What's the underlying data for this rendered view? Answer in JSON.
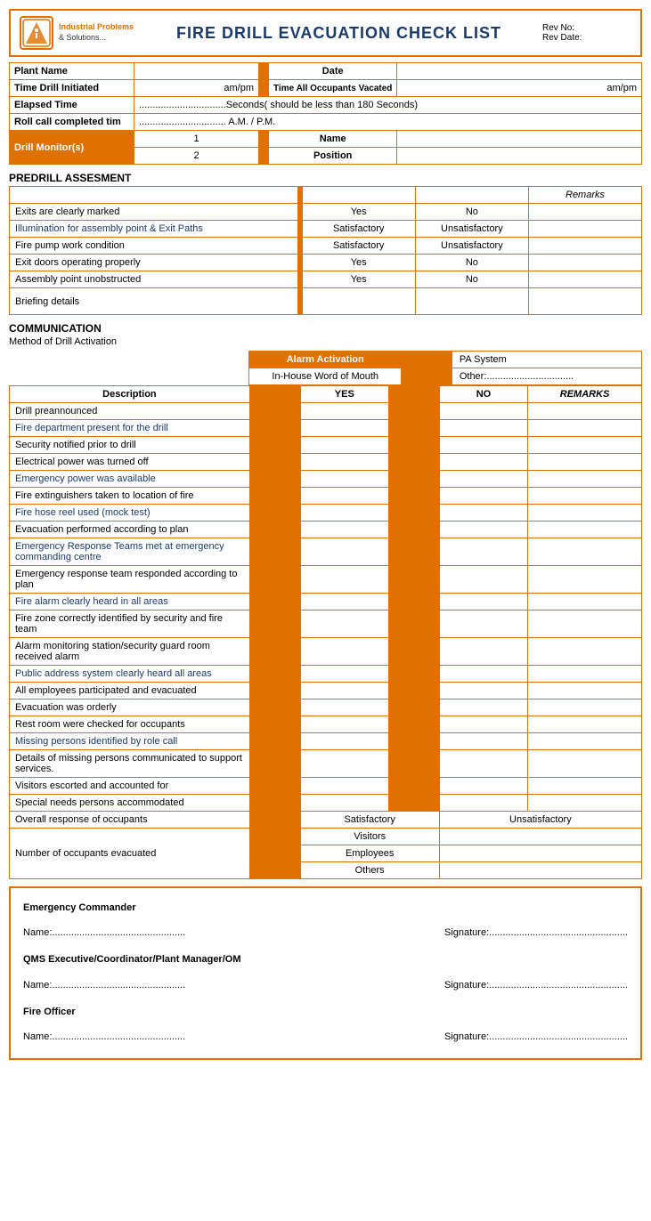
{
  "header": {
    "title": "FIRE DRILL EVACUATION CHECK LIST",
    "rev_no_label": "Rev No:",
    "rev_date_label": "Rev Date:",
    "logo_line1": "Industrial Problems",
    "logo_line2": "& Solutions..."
  },
  "form": {
    "plant_name_label": "Plant Name",
    "date_label": "Date",
    "time_drill_label": "Time Drill Initiated",
    "ampm1": "am/pm",
    "time_vacated_label": "Time All Occupants Vacated",
    "ampm2": "am/pm",
    "elapsed_label": "Elapsed Time",
    "elapsed_value": "................................Seconds( should be less than 180 Seconds)",
    "rollcall_label": "Roll call completed tim",
    "rollcall_value": "................................ A.M. / P.M.",
    "monitor_label": "Drill Monitor(s)",
    "monitor1_num": "1",
    "monitor1_field": "Name",
    "monitor2_num": "2",
    "monitor2_field": "Position"
  },
  "predrill": {
    "title": "PREDRILL ASSESMENT",
    "remarks_label": "Remarks",
    "rows": [
      {
        "label": "Exits are clearly marked",
        "col1": "Yes",
        "col2": "No",
        "blue": false
      },
      {
        "label": "Illumination for assembly point & Exit Paths",
        "col1": "Satisfactory",
        "col2": "Unsatisfactory",
        "blue": true
      },
      {
        "label": "Fire pump work condition",
        "col1": "Satisfactory",
        "col2": "Unsatisfactory",
        "blue": false
      },
      {
        "label": "Exit doors operating properly",
        "col1": "Yes",
        "col2": "No",
        "blue": false
      },
      {
        "label": "Assembly point unobstructed",
        "col1": "Yes",
        "col2": "No",
        "blue": false
      },
      {
        "label": "Briefing details",
        "col1": "",
        "col2": "",
        "blue": false,
        "tall": true
      }
    ]
  },
  "communication": {
    "title": "COMMUNICATION",
    "method_label": "Method of Drill Activation",
    "alarm_label": "Alarm Activation",
    "pa_label": "PA System",
    "inhouse_label": "In-House Word of Mouth",
    "other_label": "Other:................................",
    "col_desc": "Description",
    "col_yes": "YES",
    "col_no": "NO",
    "col_remarks": "REMARKS",
    "rows": [
      {
        "label": "Drill preannounced",
        "blue": false
      },
      {
        "label": "Fire department present for the drill",
        "blue": true
      },
      {
        "label": "Security notified prior to drill",
        "blue": false
      },
      {
        "label": "Electrical power was turned off",
        "blue": false
      },
      {
        "label": "Emergency power was available",
        "blue": true
      },
      {
        "label": "Fire extinguishers taken to location of fire",
        "blue": false
      },
      {
        "label": "Fire hose reel used (mock test)",
        "blue": true
      },
      {
        "label": "Evacuation performed according to plan",
        "blue": false
      },
      {
        "label": "Emergency Response Teams met at emergency commanding centre",
        "blue": true
      },
      {
        "label": "Emergency response team responded according to plan",
        "blue": false
      },
      {
        "label": "Fire alarm clearly heard in all areas",
        "blue": true
      },
      {
        "label": "Fire zone correctly identified by security and fire team",
        "blue": false
      },
      {
        "label": "Alarm monitoring station/security guard room received alarm",
        "blue": false
      },
      {
        "label": "Public address system clearly heard all areas",
        "blue": true
      },
      {
        "label": "All employees participated and evacuated",
        "blue": false
      },
      {
        "label": "Evacuation was orderly",
        "blue": false
      },
      {
        "label": "Rest room were checked for occupants",
        "blue": false
      },
      {
        "label": "Missing persons identified by role call",
        "blue": true
      },
      {
        "label": "Details of missing persons communicated to support services.",
        "blue": false
      },
      {
        "label": "Visitors escorted and accounted for",
        "blue": false
      },
      {
        "label": "Special needs persons accommodated",
        "blue": false
      }
    ],
    "overall_label": "Overall response of occupants",
    "overall_sat": "Satisfactory",
    "overall_unsat": "Unsatisfactory",
    "occupants_label": "Number of occupants evacuated",
    "visitors": "Visitors",
    "employees": "Employees",
    "others": "Others"
  },
  "signatures": {
    "ec_title": "Emergency Commander",
    "name_label": "Name:.................................................",
    "sig_label": "Signature:...................................................",
    "qms_title": "QMS Executive/Coordinator/Plant Manager/OM",
    "fo_title": "Fire Officer",
    "name2": "Name:.................................................",
    "sig2": "Signature:...................................................",
    "name3": "Name:.................................................",
    "sig3": "Signature:..................................................."
  }
}
